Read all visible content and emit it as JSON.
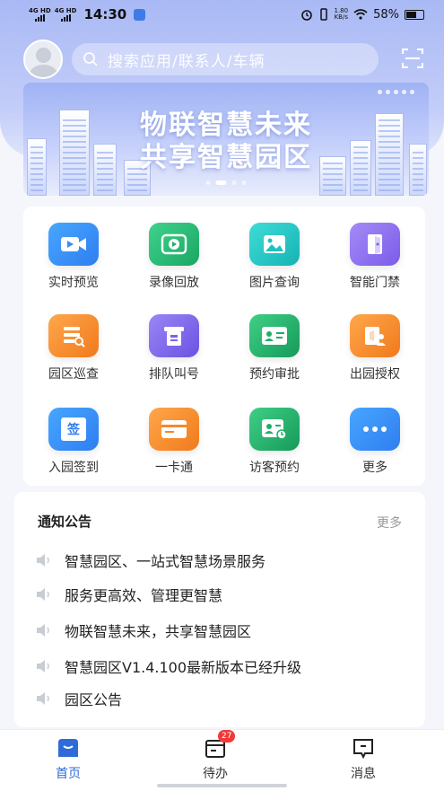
{
  "status_bar": {
    "signal_1": "4G HD",
    "signal_2": "4G HD",
    "time": "14:30",
    "net_speed_value": "1.80",
    "net_speed_unit": "KB/s",
    "battery": "58%"
  },
  "header": {
    "search_placeholder": "搜索应用/联系人/车辆"
  },
  "banner": {
    "line1": "物联智慧未来",
    "line2": "共享智慧园区"
  },
  "menu": {
    "items": [
      {
        "label": "实时预览",
        "icon": "video-camera-icon",
        "color": "#2f8cf0"
      },
      {
        "label": "录像回放",
        "icon": "video-playback-icon",
        "color": "#20b673"
      },
      {
        "label": "图片查询",
        "icon": "image-icon",
        "color": "#1cc3c1"
      },
      {
        "label": "智能门禁",
        "icon": "door-access-icon",
        "color": "#8d6bf1"
      },
      {
        "label": "园区巡查",
        "icon": "patrol-inspect-icon",
        "color": "#f58a26"
      },
      {
        "label": "排队叫号",
        "icon": "queue-ticket-icon",
        "color": "#7b63ea"
      },
      {
        "label": "预约审批",
        "icon": "approval-card-icon",
        "color": "#1fae68"
      },
      {
        "label": "出园授权",
        "icon": "exit-authorize-icon",
        "color": "#f58a26"
      },
      {
        "label": "入园签到",
        "icon": "sign-in-icon",
        "color": "#2f8cf0"
      },
      {
        "label": "一卡通",
        "icon": "card-icon",
        "color": "#f58a26"
      },
      {
        "label": "访客预约",
        "icon": "visitor-booking-icon",
        "color": "#1fae68"
      },
      {
        "label": "更多",
        "icon": "more-dots-icon",
        "color": "#2f8cf0"
      }
    ],
    "sign_char": "签"
  },
  "notice": {
    "title": "通知公告",
    "more": "更多",
    "items": [
      "智慧园区、一站式智慧场景服务",
      "服务更高效、管理更智慧",
      "物联智慧未来，共享智慧园区",
      "智慧园区V1.4.100最新版本已经升级",
      "园区公告"
    ]
  },
  "tabbar": {
    "tabs": [
      {
        "label": "首页",
        "active": true
      },
      {
        "label": "待办",
        "badge": "27"
      },
      {
        "label": "消息"
      }
    ]
  },
  "colors": {
    "accent": "#2f6bd8",
    "badge": "#f0393a"
  }
}
